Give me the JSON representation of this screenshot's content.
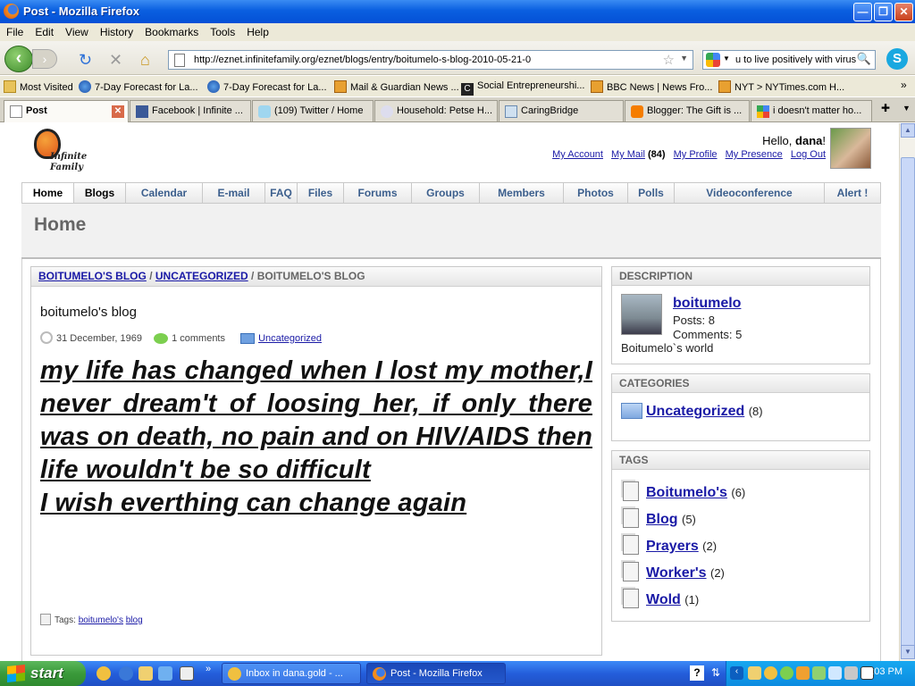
{
  "window": {
    "title": "Post - Mozilla Firefox"
  },
  "menu": [
    "File",
    "Edit",
    "View",
    "History",
    "Bookmarks",
    "Tools",
    "Help"
  ],
  "toolbar": {
    "url": "http://eznet.infinitefamily.org/eznet/blogs/entry/boitumelo-s-blog-2010-05-21-0",
    "search_value": "u to live positively with virus"
  },
  "bookmarks": [
    {
      "label": "Most Visited",
      "icon": "folder-icon"
    },
    {
      "label": "7-Day Forecast for La...",
      "icon": "noaa-icon"
    },
    {
      "label": "7-Day Forecast for La...",
      "icon": "noaa-icon"
    },
    {
      "label": "Mail & Guardian News ...",
      "icon": "rss-icon"
    },
    {
      "label": "Social Entrepreneurshi...",
      "icon": "c-icon"
    },
    {
      "label": "BBC News | News Fro...",
      "icon": "rss-icon"
    },
    {
      "label": "NYT > NYTimes.com H...",
      "icon": "rss-icon"
    }
  ],
  "tabs": [
    {
      "label": "Post",
      "active": true
    },
    {
      "label": "Facebook | Infinite ..."
    },
    {
      "label": "(109) Twitter / Home"
    },
    {
      "label": "Household: Petse H..."
    },
    {
      "label": "CaringBridge"
    },
    {
      "label": "Blogger: The Gift is ..."
    },
    {
      "label": "i doesn't matter ho..."
    }
  ],
  "header": {
    "logo_line1": "Infinite",
    "logo_line2": "Family",
    "hello": "Hello,",
    "user": "dana",
    "account_links": [
      "My Account",
      "My Mail",
      "(84)",
      "My Profile",
      "My Presence",
      "Log Out"
    ]
  },
  "nav": [
    "Home",
    "Blogs",
    "Calendar",
    "E-mail",
    "FAQ",
    "Files",
    "Forums",
    "Groups",
    "Members",
    "Photos",
    "Polls",
    "Videoconference",
    "Alert !"
  ],
  "page": {
    "title": "Home"
  },
  "post": {
    "breadcrumb": [
      "BOITUMELO'S BLOG",
      "UNCATEGORIZED",
      "BOITUMELO'S BLOG"
    ],
    "sep": "/",
    "title": "boitumelo's blog",
    "date": "31 December, 1969",
    "comments": "1 comments",
    "category": "Uncategorized",
    "body_line1": "my life has changed when I lost  my mother,I never dream't of loosing her, if only there was on death, no pain and on HIV/AIDS then life wouldn't be so difficult",
    "body_line2": "I wish everthing can change again",
    "tags_label": "Tags:",
    "tags": [
      "boitumelo's",
      "blog"
    ]
  },
  "description": {
    "heading": "DESCRIPTION",
    "name": "boitumelo",
    "posts": "Posts: 8",
    "comments": "Comments: 5",
    "world": "Boitumelo`s world"
  },
  "categories": {
    "heading": "CATEGORIES",
    "items": [
      {
        "label": "Uncategorized",
        "count": "(8)"
      }
    ]
  },
  "tags_box": {
    "heading": "TAGS",
    "items": [
      {
        "label": "Boitumelo's",
        "count": "(6)"
      },
      {
        "label": "Blog",
        "count": "(5)"
      },
      {
        "label": "Prayers",
        "count": "(2)"
      },
      {
        "label": "Worker's",
        "count": "(2)"
      },
      {
        "label": "Wold",
        "count": "(1)"
      }
    ]
  },
  "taskbar": {
    "start": "start",
    "items": [
      {
        "label": "Inbox in dana.gold - ..."
      },
      {
        "label": "Post - Mozilla Firefox",
        "active": true
      }
    ],
    "time": "2:03 PM"
  }
}
